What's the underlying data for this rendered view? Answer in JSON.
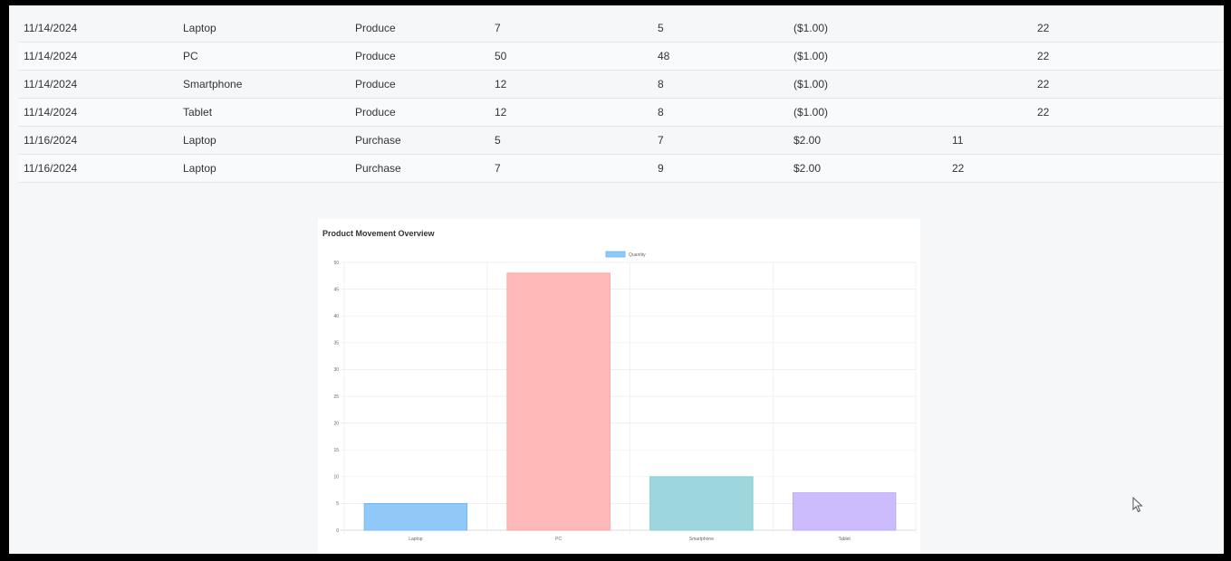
{
  "table": {
    "rows": [
      [
        "11/14/2024",
        "Laptop",
        "Produce",
        "7",
        "5",
        "($1.00)",
        "",
        "22"
      ],
      [
        "11/14/2024",
        "PC",
        "Produce",
        "50",
        "48",
        "($1.00)",
        "",
        "22"
      ],
      [
        "11/14/2024",
        "Smartphone",
        "Produce",
        "12",
        "8",
        "($1.00)",
        "",
        "22"
      ],
      [
        "11/14/2024",
        "Tablet",
        "Produce",
        "12",
        "8",
        "($1.00)",
        "",
        "22"
      ],
      [
        "11/16/2024",
        "Laptop",
        "Purchase",
        "5",
        "7",
        "$2.00",
        "11",
        ""
      ],
      [
        "11/16/2024",
        "Laptop",
        "Purchase",
        "7",
        "9",
        "$2.00",
        "22",
        ""
      ]
    ]
  },
  "chart_data": {
    "type": "bar",
    "title": "Product Movement Overview",
    "legend": [
      "Quantity"
    ],
    "legend_position": "top-center",
    "categories": [
      "Laptop",
      "PC",
      "Smartphone",
      "Tablet"
    ],
    "series": [
      {
        "name": "Quantity",
        "values": [
          5,
          48,
          10,
          7
        ]
      }
    ],
    "ylim": [
      0,
      50
    ],
    "yticks": [
      0,
      5,
      10,
      15,
      20,
      25,
      30,
      35,
      40,
      45,
      50
    ],
    "grid": true,
    "colors": [
      "#90c8f8",
      "#ffb9b9",
      "#9dd6dc",
      "#ccbcfd"
    ],
    "border_colors": [
      "#6eb4f0",
      "#ff9a9a",
      "#7cc8cf",
      "#b8a3fb"
    ]
  },
  "cursor_icon": "mouse-pointer-icon"
}
